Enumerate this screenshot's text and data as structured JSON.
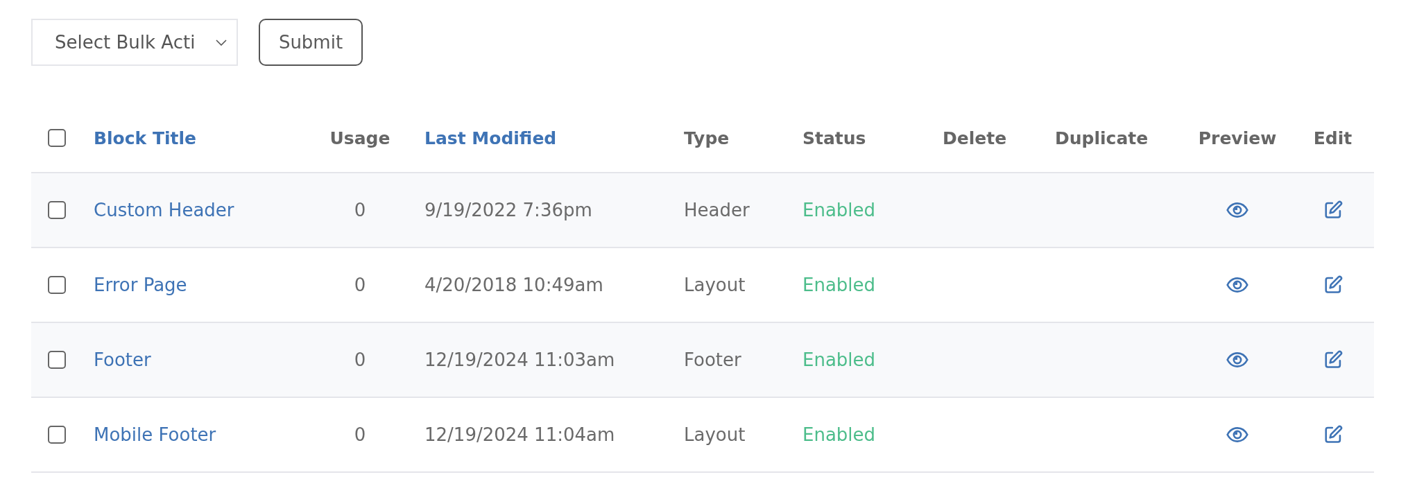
{
  "bulk_actions": {
    "dropdown": {
      "value": "Select Bulk Acti"
    },
    "submit_button": "Submit"
  },
  "table": {
    "select_all": {
      "checked": false
    },
    "columns": [
      {
        "label": "Block Title",
        "sortable": true
      },
      {
        "label": "Usage",
        "sortable": false
      },
      {
        "label": "Last Modified",
        "sortable": true
      },
      {
        "label": "Type",
        "sortable": false
      },
      {
        "label": "Status",
        "sortable": false
      },
      {
        "label": "Delete",
        "sortable": false
      },
      {
        "label": "Duplicate",
        "sortable": false
      },
      {
        "label": "Preview",
        "sortable": false
      },
      {
        "label": "Edit",
        "sortable": false
      }
    ],
    "rows": [
      {
        "checked": false,
        "title": "Custom Header",
        "usage": "0",
        "last_modified": "9/19/2022 7:36pm",
        "type": "Header",
        "status": "Enabled"
      },
      {
        "checked": false,
        "title": "Error Page",
        "usage": "0",
        "last_modified": "4/20/2018 10:49am",
        "type": "Layout",
        "status": "Enabled"
      },
      {
        "checked": false,
        "title": "Footer",
        "usage": "0",
        "last_modified": "12/19/2024 11:03am",
        "type": "Footer",
        "status": "Enabled"
      },
      {
        "checked": false,
        "title": "Mobile Footer",
        "usage": "0",
        "last_modified": "12/19/2024 11:04am",
        "type": "Layout",
        "status": "Enabled"
      }
    ]
  }
}
